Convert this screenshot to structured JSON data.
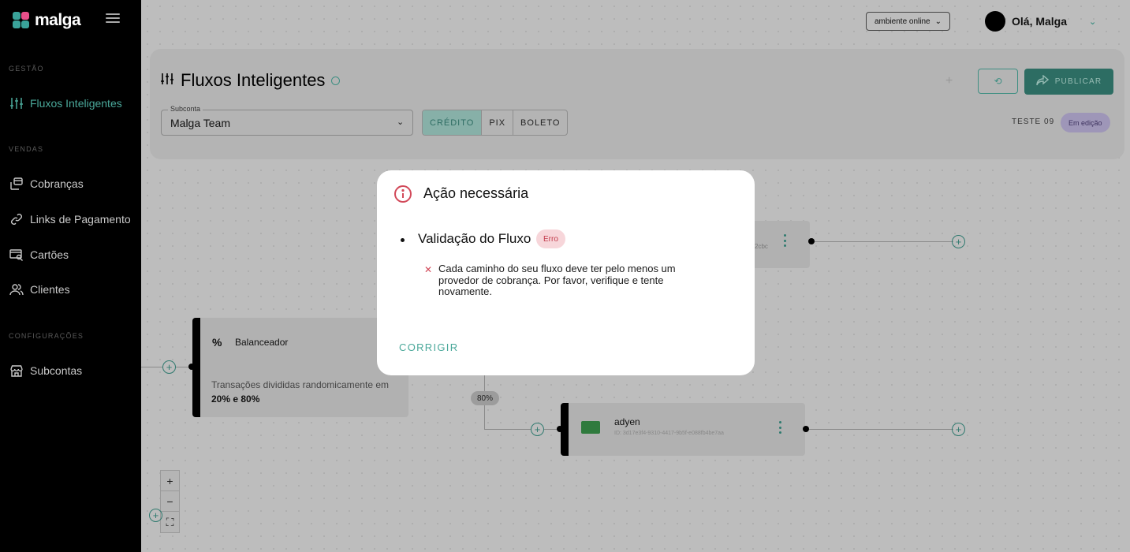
{
  "app": {
    "logo_text": "malga"
  },
  "sidebar": {
    "sections": [
      {
        "label": "GESTÃO"
      },
      {
        "label": "VENDAS"
      },
      {
        "label": "CONFIGURAÇÕES"
      }
    ],
    "items": [
      {
        "label": "Fluxos Inteligentes",
        "icon": "sliders-icon",
        "active": true
      },
      {
        "label": "Cobranças",
        "icon": "charges-icon"
      },
      {
        "label": "Links de Pagamento",
        "icon": "link-icon"
      },
      {
        "label": "Cartões",
        "icon": "card-search-icon"
      },
      {
        "label": "Clientes",
        "icon": "users-icon"
      },
      {
        "label": "Subcontas",
        "icon": "store-icon"
      }
    ]
  },
  "topbar": {
    "environment": "ambiente online",
    "greeting": "Olá, Malga"
  },
  "header": {
    "title": "Fluxos Inteligentes",
    "subconta_label": "Subconta",
    "subconta_value": "Malga Team",
    "tabs": [
      {
        "label": "CRÉDITO",
        "active": true
      },
      {
        "label": "PIX"
      },
      {
        "label": "BOLETO"
      }
    ],
    "add_symbol": "+",
    "publish_label": "PUBLICAR",
    "flow_name": "TESTE 09",
    "status": "Em edição"
  },
  "canvas": {
    "balancer": {
      "title": "Balanceador",
      "icon": "%",
      "description": "Transações divididas randomicamente em",
      "split": "20% e 80%"
    },
    "top_node": {
      "id_fragment": "2cbc"
    },
    "percent_badge": "80%",
    "provider": {
      "name": "adyen",
      "id": "ID: 3d17e3f4-9310-4417-9b5f-e088fb4be7aa"
    },
    "zoom": {
      "in": "+",
      "out": "−",
      "fit": "⛶"
    }
  },
  "modal": {
    "title": "Ação necessária",
    "validation_title": "Validação do Fluxo",
    "badge": "Erro",
    "error_message": "Cada caminho do seu fluxo deve ter pelo menos um provedor de cobrança. Por favor, verifique e tente novamente.",
    "action_label": "CORRIGIR"
  },
  "colors": {
    "accent": "#4aa89a",
    "error": "#d24a5a",
    "sidebar_bg": "#000000"
  }
}
